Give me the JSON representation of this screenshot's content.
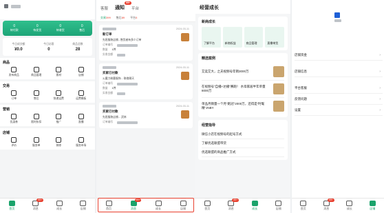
{
  "panel1": {
    "green_stats": [
      {
        "value": "0",
        "label": "待付款"
      },
      {
        "value": "0",
        "label": "待发货"
      },
      {
        "value": "0",
        "label": "待收货"
      },
      {
        "value": "0",
        "label": "售后"
      }
    ],
    "stats": [
      {
        "label": "今日成交额",
        "value": "¥0.0"
      },
      {
        "label": "今日访客",
        "value": "0"
      },
      {
        "label": "商品总数",
        "value": "28"
      }
    ],
    "sections": [
      {
        "title": "商品",
        "items": [
          "发布商品",
          "商品管理",
          "素材",
          "店铺"
        ]
      },
      {
        "title": "交易",
        "items": [
          "订单",
          "售后",
          "快递运费",
          "运费模板"
        ]
      },
      {
        "title": "营销",
        "items": [
          "优惠券",
          "限时折扣",
          "推广",
          "直播"
        ]
      },
      {
        "title": "店铺",
        "items": [
          "评价",
          "服务单",
          "装修",
          "服务市场"
        ]
      }
    ]
  },
  "panel2": {
    "tab_service": "客服",
    "tab_notice": "通知",
    "notice_badge": "99+",
    "tab_growth": "平台",
    "subtabs": [
      "交易",
      "售后",
      "平台"
    ],
    "subtab_counts": [
      "399",
      "89",
      "5"
    ],
    "orders": [
      {
        "date": "2024-03-11",
        "title": "新订单",
        "text": "先屈服装店铺...售货者有多少订单",
        "rows": [
          [
            "订单编号",
            ""
          ],
          [
            "数量",
            "1件"
          ],
          [
            "实收金额",
            ""
          ]
        ]
      },
      {
        "date": "2024-03-11",
        "title": "买家已付款",
        "text": "火魔力粉墨服饰... 联络聊天",
        "rows": [
          [
            "订单编号",
            ""
          ],
          [
            "数量",
            "1件"
          ],
          [
            "实收金额",
            ""
          ]
        ]
      },
      {
        "date": "2024-03-11",
        "title": "买家已付款",
        "text": "先屈服装店铺... 武林",
        "rows": [
          [
            "订单编号",
            ""
          ]
        ]
      }
    ]
  },
  "panel3": {
    "title": "经营成长",
    "new_merchant": {
      "title": "新商成长",
      "tiles": [
        "了解平台",
        "新商权益",
        "商品管理",
        "直播带货"
      ]
    },
    "cases": {
      "title": "精选案例",
      "items": [
        "艾奕艾大，之夫视频号年销3000万",
        "在视频号\"自播+达播\"赛跑！ 水母家居半年单量8000万",
        "单品月销量一个月\"跑冠\"2000万，还得是\"时髦精\"JNBY"
      ]
    },
    "guide": {
      "title": "经营指导",
      "items": [
        "微信小店在视频号的起号方式",
        "了解优选联盟带货",
        "优选联盟的商品推广方式"
      ]
    }
  },
  "panel4": {
    "items": [
      "店铺资金",
      "店铺信息",
      "平台客服",
      "反馈问题",
      "设置"
    ]
  },
  "tabbar": {
    "items": [
      "首页",
      "消息",
      "成长",
      "店铺"
    ],
    "msg_badge": "99+"
  }
}
